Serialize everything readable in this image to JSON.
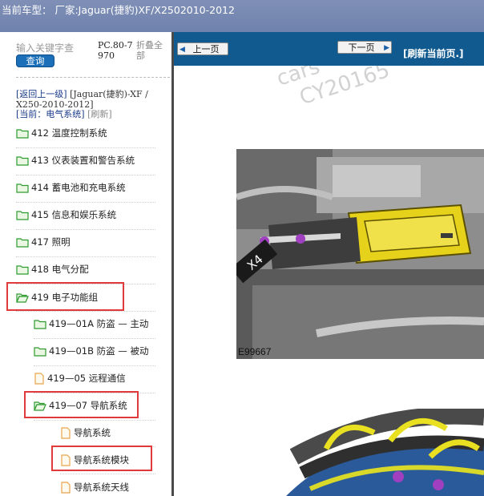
{
  "header": {
    "title": "当前车型： 厂家:Jaguar(捷豹)XF/X2502010-2012"
  },
  "search": {
    "placeholder": "输入关键字查",
    "button_label": "查询"
  },
  "toolbar": {
    "pc_code": "PC.80-7970",
    "collapse_label": "折叠全部"
  },
  "breadcrumb": {
    "back": "[返回上一级]",
    "model": "[Jaguar(捷豹)-XF / X250-2010-2012]",
    "current": "[当前：电气系统]",
    "refresh": "[刷新]"
  },
  "tree": [
    {
      "label": "412 温度控制系统",
      "type": "folder"
    },
    {
      "label": "413 仪表装置和警告系统",
      "type": "folder"
    },
    {
      "label": "414 蓄电池和充电系统",
      "type": "folder"
    },
    {
      "label": "415 信息和娱乐系统",
      "type": "folder"
    },
    {
      "label": "417 照明",
      "type": "folder"
    },
    {
      "label": "418 电气分配",
      "type": "folder"
    },
    {
      "label": "419 电子功能组",
      "type": "folder-open",
      "highlighted": true
    },
    {
      "label": "419—01A 防盗 — 主动",
      "type": "folder"
    },
    {
      "label": "419—01B 防盗 — 被动",
      "type": "folder"
    },
    {
      "label": "419—05 远程通信",
      "type": "doc"
    },
    {
      "label": "419—07 导航系统",
      "type": "folder-open",
      "highlighted": true
    },
    {
      "label": "导航系统",
      "type": "doc"
    },
    {
      "label": "导航系统模块",
      "type": "doc",
      "highlighted": true
    },
    {
      "label": "导航系统天线",
      "type": "doc"
    }
  ],
  "nav": {
    "prev_label": "上一页",
    "next_label": "下一页",
    "refresh_label": "[刷新当前页.]"
  },
  "content": {
    "watermark_1": "cars",
    "watermark_2": "CY20165",
    "figure_code": "E99667",
    "callout": "X4"
  },
  "colors": {
    "nav_bg": "#115a8f",
    "highlight": "#e03a3a",
    "folder": "#2f9a2f",
    "doc": "#e8a44a"
  }
}
